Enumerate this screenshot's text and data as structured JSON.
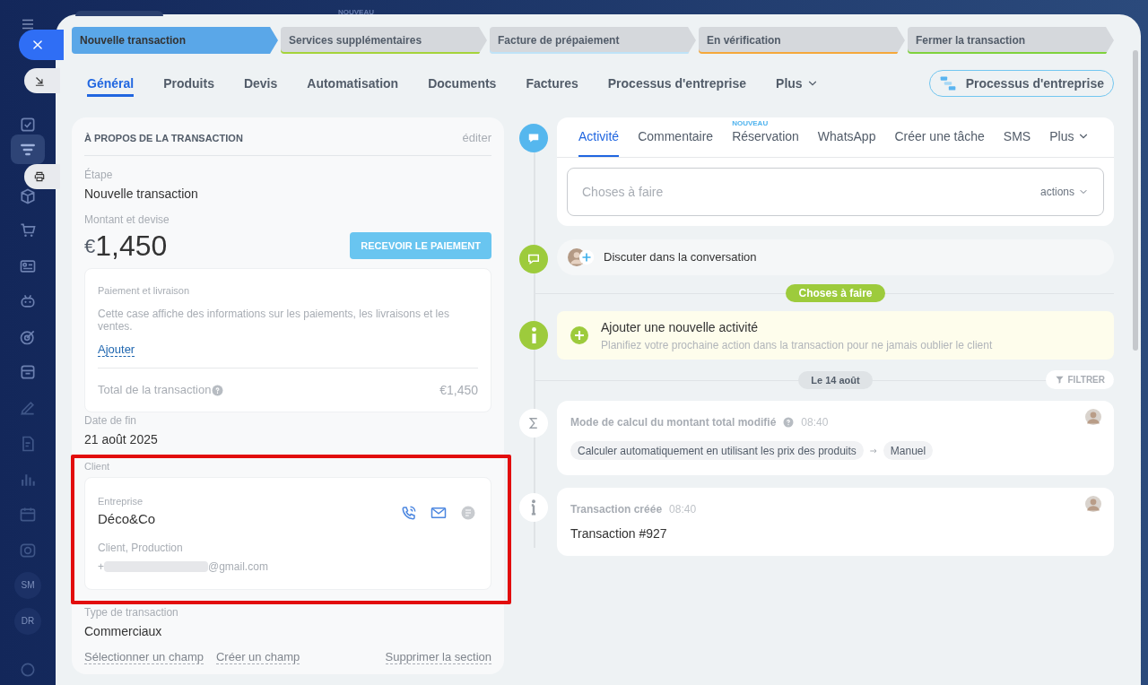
{
  "top_badge": "NOUVEAU",
  "sidebar": {
    "items": [
      {
        "kind": "check",
        "selected": false
      },
      {
        "kind": "filter",
        "selected": true
      },
      {
        "kind": "cube",
        "selected": false
      },
      {
        "kind": "cart",
        "selected": false
      },
      {
        "kind": "card",
        "selected": false
      },
      {
        "kind": "robot",
        "selected": false
      },
      {
        "kind": "target",
        "selected": false
      },
      {
        "kind": "archive",
        "selected": false
      },
      {
        "kind": "pen",
        "selected": false
      },
      {
        "kind": "document",
        "selected": false
      },
      {
        "kind": "chart",
        "selected": false
      },
      {
        "kind": "calendar",
        "selected": false
      },
      {
        "kind": "camera",
        "selected": false
      },
      {
        "kind": "initials",
        "label": "SM",
        "selected": false
      },
      {
        "kind": "initials",
        "label": "DR",
        "selected": false
      },
      {
        "kind": "circle",
        "selected": false
      }
    ]
  },
  "stages": [
    {
      "label": "Nouvelle transaction",
      "selected": true,
      "color": "#5aa7e8"
    },
    {
      "label": "Services supplémentaires",
      "selected": false,
      "color": "#a5d43a"
    },
    {
      "label": "Facture de prépaiement",
      "selected": false,
      "color": "#bfe3f7"
    },
    {
      "label": "En vérification",
      "selected": false,
      "color": "#f5a83a"
    },
    {
      "label": "Fermer la transaction",
      "selected": false,
      "color": "#7fd23c"
    }
  ],
  "tabs": [
    {
      "label": "Général",
      "selected": true,
      "has_menu": false
    },
    {
      "label": "Produits",
      "selected": false,
      "has_menu": false
    },
    {
      "label": "Devis",
      "selected": false,
      "has_menu": false
    },
    {
      "label": "Automatisation",
      "selected": false,
      "has_menu": false
    },
    {
      "label": "Documents",
      "selected": false,
      "has_menu": false
    },
    {
      "label": "Factures",
      "selected": false,
      "has_menu": false
    },
    {
      "label": "Processus d'entreprise",
      "selected": false,
      "has_menu": false
    },
    {
      "label": "Plus",
      "selected": false,
      "has_menu": true
    }
  ],
  "process_button": "Processus d'entreprise",
  "about": {
    "title": "À PROPOS DE LA TRANSACTION",
    "edit": "éditer",
    "stage": {
      "label": "Étape",
      "value": "Nouvelle transaction"
    },
    "amount": {
      "label": "Montant et devise",
      "currency": "€",
      "value": "1,450",
      "button": "RECEVOIR LE PAIEMENT"
    },
    "payment": {
      "title": "Paiement et livraison",
      "text": "Cette case affiche des informations sur les paiements, les livraisons et les ventes.",
      "link": "Ajouter",
      "total_label": "Total de la transaction",
      "total_value": "€1,450"
    },
    "end_date": {
      "label": "Date de fin",
      "value": "21 août 2025"
    },
    "client": {
      "label": "Client",
      "highlighted": true,
      "type": "Entreprise",
      "name": "Déco&Co",
      "tags": "Client, Production",
      "contact_prefix": "+",
      "contact_suffix": "@gmail.com"
    },
    "deal_type": {
      "label": "Type de transaction",
      "value": "Commerciaux"
    },
    "links": [
      "Sélectionner un champ",
      "Créer un champ"
    ],
    "remove_link": "Supprimer la section"
  },
  "timeline": {
    "composer": {
      "tabs": [
        {
          "label": "Activité",
          "selected": true,
          "has_menu": false
        },
        {
          "label": "Commentaire",
          "selected": false,
          "has_menu": false
        },
        {
          "label": "Réservation",
          "selected": false,
          "has_menu": false,
          "badge": "NOUVEAU"
        },
        {
          "label": "WhatsApp",
          "selected": false,
          "has_menu": false
        },
        {
          "label": "Créer une tâche",
          "selected": false,
          "has_menu": false
        },
        {
          "label": "SMS",
          "selected": false,
          "has_menu": false
        },
        {
          "label": "Plus",
          "selected": false,
          "has_menu": true
        }
      ],
      "placeholder": "Choses à faire",
      "actions": "actions"
    },
    "chat": "Discuter dans la conversation",
    "todo_badge": "Choses à faire",
    "add_activity": {
      "title": "Ajouter une nouvelle activité",
      "text": "Planifiez votre prochaine action dans la transaction pour ne jamais oublier le client"
    },
    "date_badge": "Le 14 août",
    "filter": "FILTRER",
    "events": [
      {
        "kind": "sum",
        "title": "Mode de calcul du montant total modifié",
        "time": "08:40",
        "help": true,
        "from": "Calculer automatiquement en utilisant les prix des produits",
        "to": "Manuel"
      },
      {
        "kind": "info",
        "title": "Transaction créée",
        "time": "08:40",
        "help": false,
        "text": "Transaction #927"
      }
    ]
  }
}
